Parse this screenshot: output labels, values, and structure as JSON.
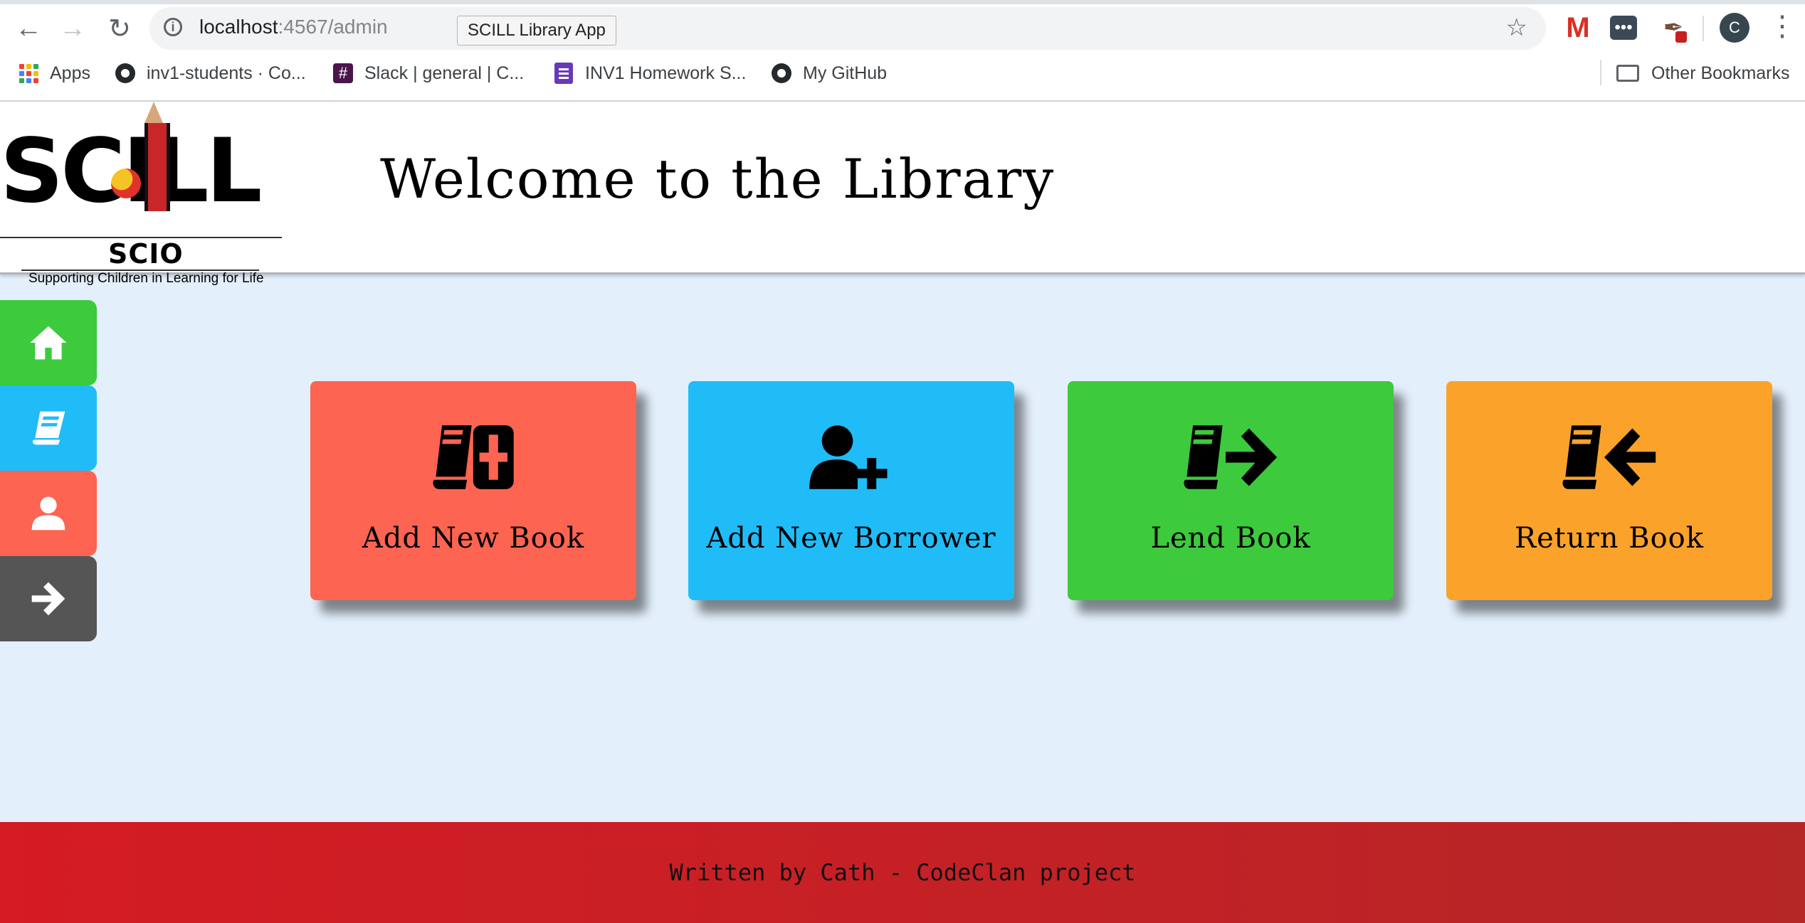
{
  "browser": {
    "url_host": "localhost",
    "url_path": ":4567/admin",
    "tab_tooltip": "SCILL Library App",
    "avatar_initial": "C",
    "bookmarks": [
      {
        "label": "Apps",
        "icon": "apps-grid-icon"
      },
      {
        "label": "inv1-students · Co...",
        "icon": "github-icon"
      },
      {
        "label": "Slack | general | C...",
        "icon": "slack-icon"
      },
      {
        "label": "INV1 Homework S...",
        "icon": "google-forms-icon"
      },
      {
        "label": "My GitHub",
        "icon": "github-icon"
      }
    ],
    "other_bookmarks": "Other Bookmarks"
  },
  "header": {
    "logo_text": "SCILL",
    "logo_sub": "SCIO",
    "logo_tagline": "Supporting Children in Learning for Life",
    "title": "Welcome to the Library"
  },
  "sidenav": [
    {
      "name": "home",
      "icon": "home-icon",
      "color": "#3dca3d"
    },
    {
      "name": "books",
      "icon": "book-icon",
      "color": "#1fbcf8"
    },
    {
      "name": "borrowers",
      "icon": "user-icon",
      "color": "#fd6451"
    },
    {
      "name": "logout",
      "icon": "arrow-right-icon",
      "color": "#555555"
    }
  ],
  "cards": [
    {
      "label": "Add New Book",
      "icon": "book-plus-icon",
      "color": "#fd6451"
    },
    {
      "label": "Add New Borrower",
      "icon": "user-plus-icon",
      "color": "#1fbcf8"
    },
    {
      "label": "Lend Book",
      "icon": "book-arrow-right-icon",
      "color": "#3dca3d"
    },
    {
      "label": "Return Book",
      "icon": "book-arrow-left-icon",
      "color": "#fba22a"
    }
  ],
  "footer": {
    "text": "Written by Cath - CodeClan project",
    "color": "#d51b24"
  }
}
